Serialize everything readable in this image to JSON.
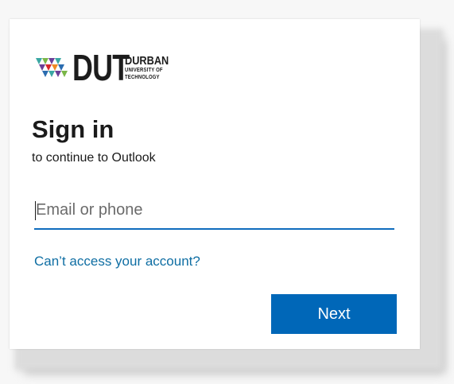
{
  "brand": {
    "logo_letters": "DUT",
    "logo_line1": "DURBAN",
    "logo_line2": "UNIVERSITY OF",
    "logo_line3": "TECHNOLOGY",
    "colors": {
      "teal": "#3aa7a3",
      "green": "#7ab648",
      "purple": "#6b3f98",
      "red": "#d9262c",
      "blue": "#2b6cb0",
      "orange": "#f08a24"
    }
  },
  "signin": {
    "title": "Sign in",
    "subtitle": "to continue to Outlook"
  },
  "email": {
    "placeholder": "Email or phone",
    "value": ""
  },
  "links": {
    "cant_access": "Can’t access your account?"
  },
  "buttons": {
    "next": "Next"
  },
  "theme": {
    "primary": "#0067b8",
    "link": "#0f6ea3",
    "underline": "#0f6cbd"
  }
}
